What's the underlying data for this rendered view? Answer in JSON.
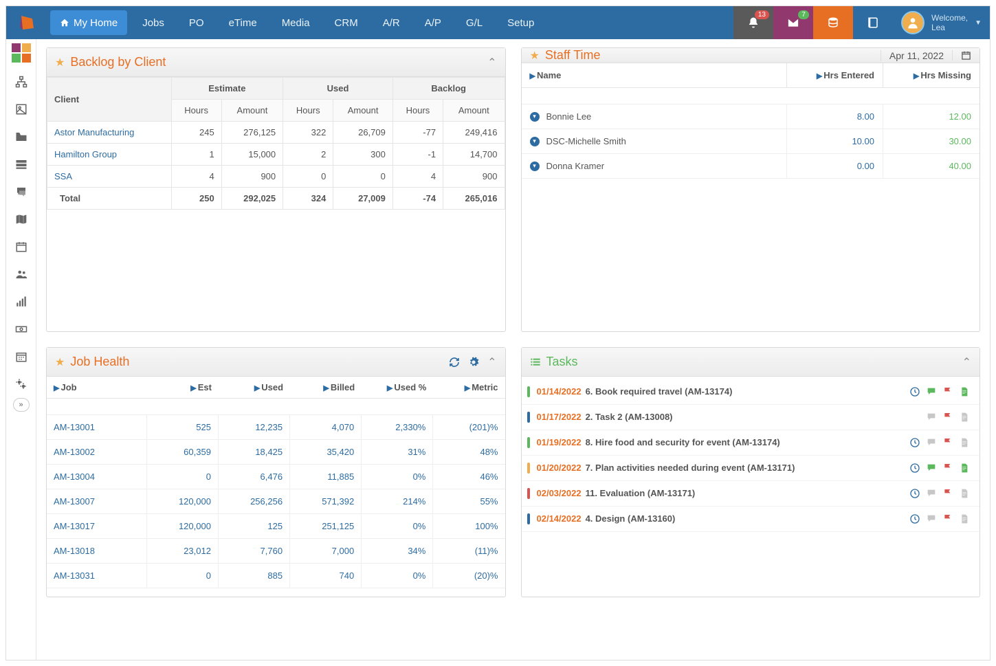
{
  "nav": {
    "items": [
      "My Home",
      "Jobs",
      "PO",
      "eTime",
      "Media",
      "CRM",
      "A/R",
      "A/P",
      "G/L",
      "Setup"
    ],
    "active": 0,
    "badges": {
      "notifications": "13",
      "messages": "7"
    },
    "welcome_label": "Welcome,",
    "username": "Lea"
  },
  "panels": {
    "backlog": {
      "title": "Backlog by Client",
      "group_headers": [
        "Estimate",
        "Used",
        "Backlog"
      ],
      "sub_headers": [
        "Client",
        "Hours",
        "Amount",
        "Hours",
        "Amount",
        "Hours",
        "Amount"
      ],
      "rows": [
        {
          "client": "Astor Manufacturing",
          "eh": "245",
          "ea": "276,125",
          "uh": "322",
          "ua": "26,709",
          "bh": "-77",
          "ba": "249,416"
        },
        {
          "client": "Hamilton Group",
          "eh": "1",
          "ea": "15,000",
          "uh": "2",
          "ua": "300",
          "bh": "-1",
          "ba": "14,700"
        },
        {
          "client": "SSA",
          "eh": "4",
          "ea": "900",
          "uh": "0",
          "ua": "0",
          "bh": "4",
          "ba": "900"
        }
      ],
      "total": {
        "label": "Total",
        "eh": "250",
        "ea": "292,025",
        "uh": "324",
        "ua": "27,009",
        "bh": "-74",
        "ba": "265,016"
      }
    },
    "staff_time": {
      "title": "Staff Time",
      "date": "Apr 11, 2022",
      "headers": [
        "Name",
        "Hrs Entered",
        "Hrs Missing"
      ],
      "rows": [
        {
          "name": "Bonnie Lee",
          "entered": "8.00",
          "missing": "12.00"
        },
        {
          "name": "DSC-Michelle Smith",
          "entered": "10.00",
          "missing": "30.00"
        },
        {
          "name": "Donna Kramer",
          "entered": "0.00",
          "missing": "40.00"
        }
      ]
    },
    "job_health": {
      "title": "Job Health",
      "headers": [
        "Job",
        "Est",
        "Used",
        "Billed",
        "Used %",
        "Metric"
      ],
      "rows": [
        {
          "job": "AM-13001",
          "est": "525",
          "used": "12,235",
          "billed": "4,070",
          "usedp": "2,330%",
          "metric": "(201)%"
        },
        {
          "job": "AM-13002",
          "est": "60,359",
          "used": "18,425",
          "billed": "35,420",
          "usedp": "31%",
          "metric": "48%"
        },
        {
          "job": "AM-13004",
          "est": "0",
          "used": "6,476",
          "billed": "11,885",
          "usedp": "0%",
          "metric": "46%"
        },
        {
          "job": "AM-13007",
          "est": "120,000",
          "used": "256,256",
          "billed": "571,392",
          "usedp": "214%",
          "metric": "55%"
        },
        {
          "job": "AM-13017",
          "est": "120,000",
          "used": "125",
          "billed": "251,125",
          "usedp": "0%",
          "metric": "100%"
        },
        {
          "job": "AM-13018",
          "est": "23,012",
          "used": "7,760",
          "billed": "7,000",
          "usedp": "34%",
          "metric": "(11)%"
        },
        {
          "job": "AM-13031",
          "est": "0",
          "used": "885",
          "billed": "740",
          "usedp": "0%",
          "metric": "(20)%"
        }
      ]
    },
    "tasks": {
      "title": "Tasks",
      "rows": [
        {
          "date": "01/14/2022",
          "text": "6. Book required travel (AM-13174)",
          "bar": "#5cb85c",
          "clock": true,
          "comment": "green",
          "doc": "green"
        },
        {
          "date": "01/17/2022",
          "text": "2. Task 2 (AM-13008)",
          "bar": "#2d6ca2",
          "clock": false,
          "comment": "grey",
          "doc": "grey"
        },
        {
          "date": "01/19/2022",
          "text": "8. Hire food and security for event (AM-13174)",
          "bar": "#5cb85c",
          "clock": true,
          "comment": "grey",
          "doc": "grey"
        },
        {
          "date": "01/20/2022",
          "text": "7. Plan activities needed during event (AM-13171)",
          "bar": "#f0ad4e",
          "clock": true,
          "comment": "green",
          "doc": "green"
        },
        {
          "date": "02/03/2022",
          "text": "11. Evaluation (AM-13171)",
          "bar": "#d9534f",
          "clock": true,
          "comment": "grey",
          "doc": "grey"
        },
        {
          "date": "02/14/2022",
          "text": "4. Design (AM-13160)",
          "bar": "#2d6ca2",
          "clock": true,
          "comment": "grey",
          "doc": "grey"
        }
      ]
    }
  }
}
